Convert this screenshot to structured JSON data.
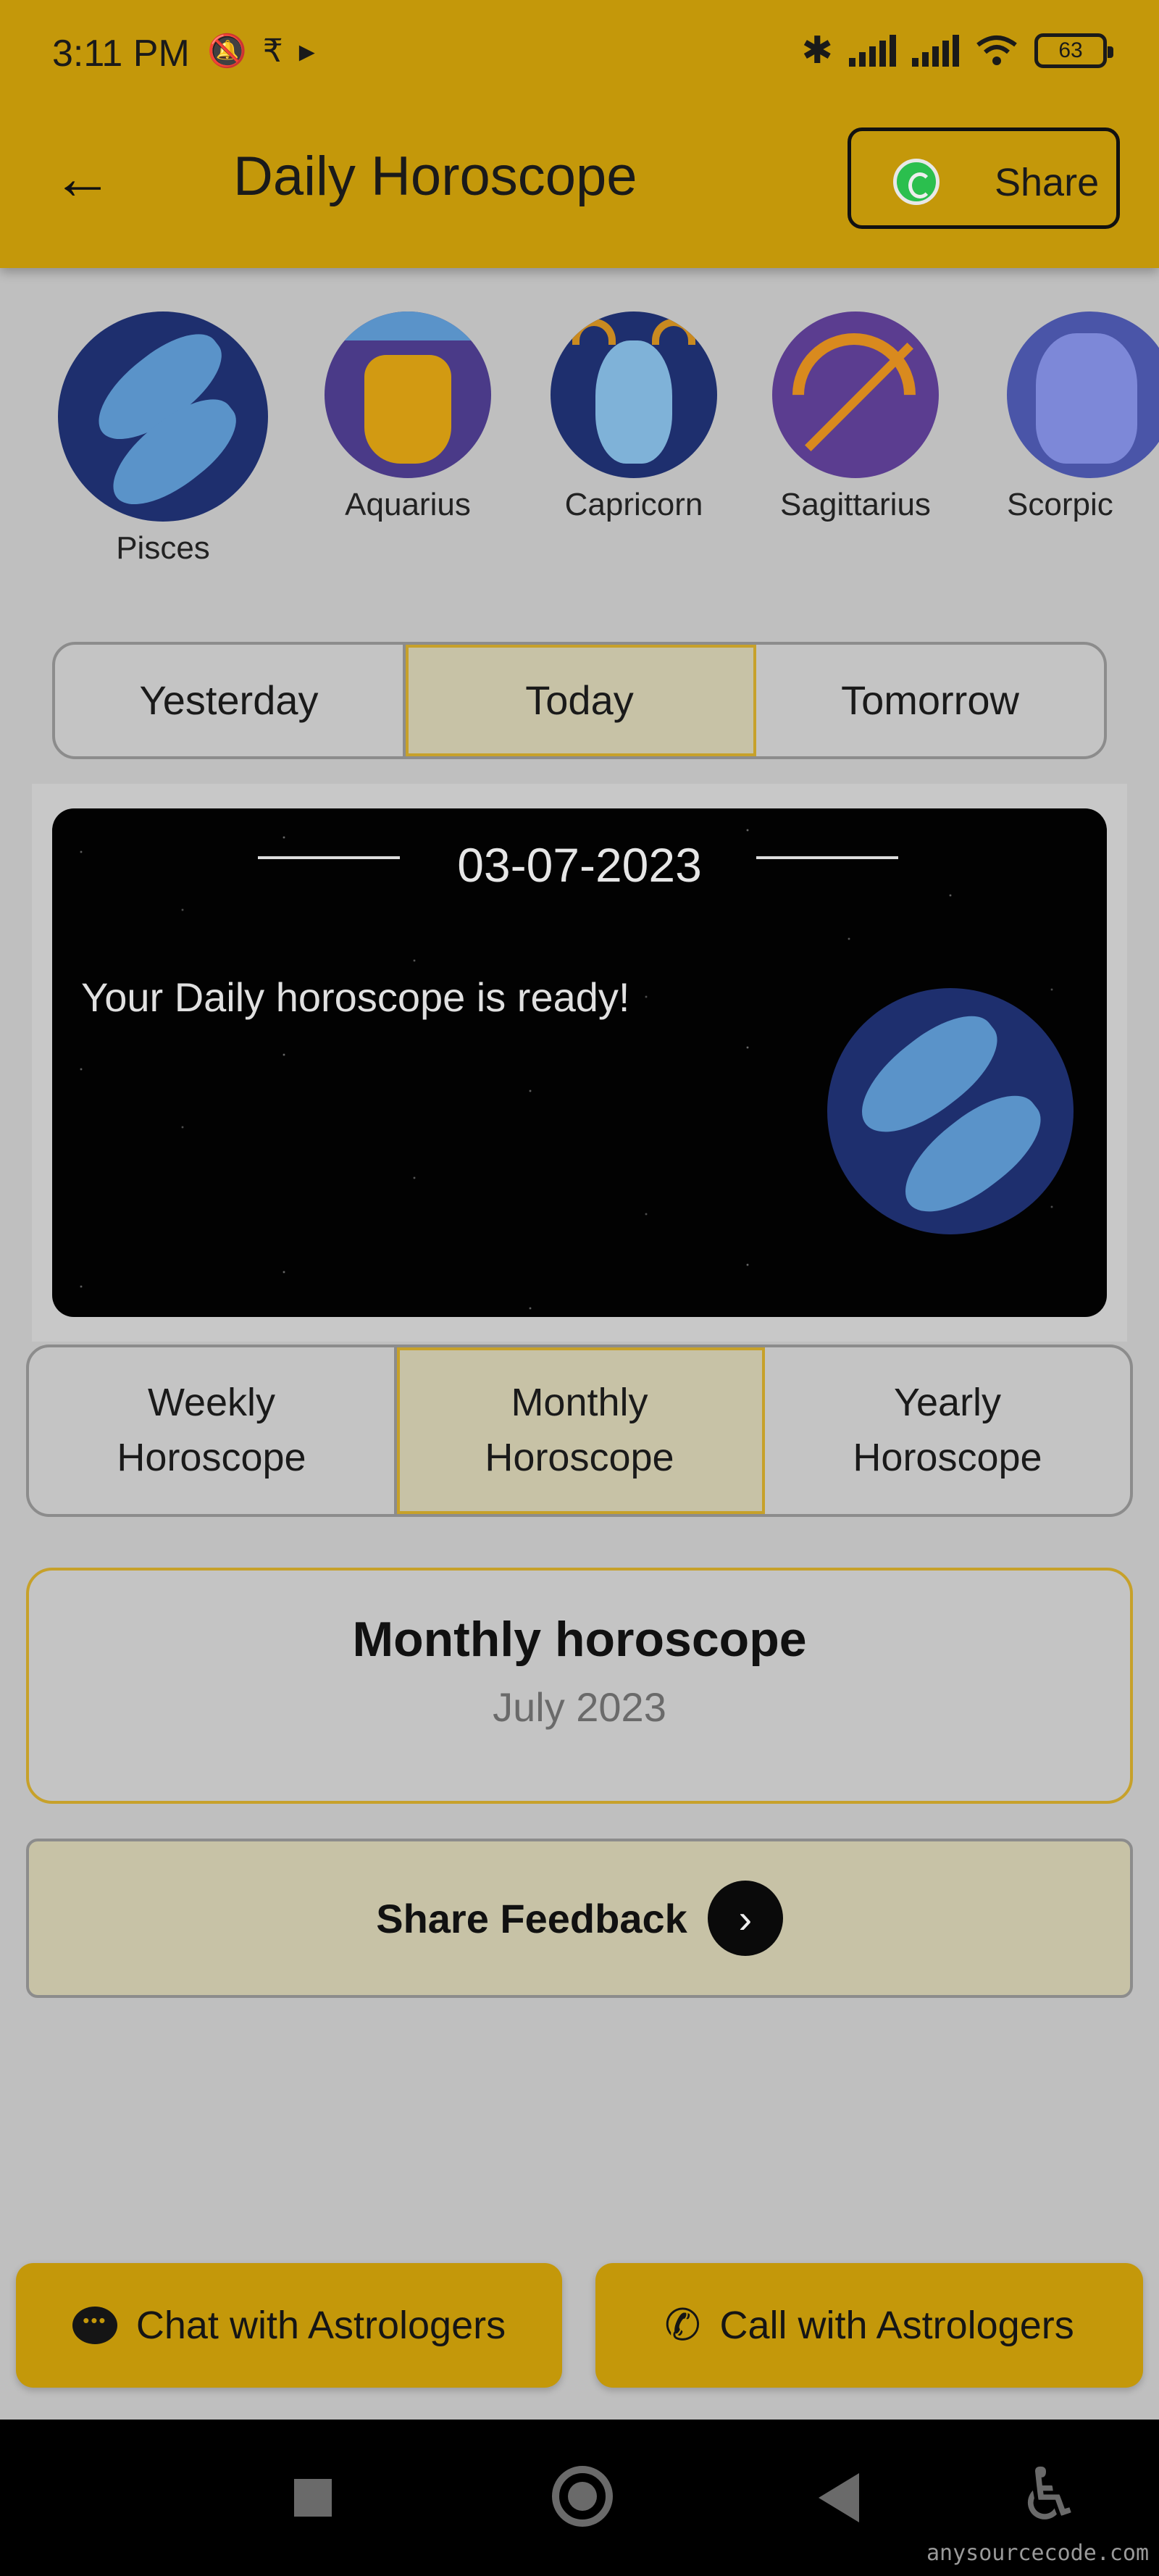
{
  "status_bar": {
    "time": "3:11 PM",
    "icons_left": [
      "mute-icon",
      "rupee-app-icon",
      "play-icon"
    ],
    "icons_right": [
      "bluetooth-icon",
      "signal-icon",
      "signal-icon",
      "wifi-icon",
      "battery-icon"
    ],
    "battery": "63"
  },
  "header": {
    "title": "Daily Horoscope",
    "share_label": "Share",
    "background": "#c4980a"
  },
  "zodiac_signs": [
    {
      "label": "Pisces",
      "selected": true
    },
    {
      "label": "Aquarius"
    },
    {
      "label": "Capricorn"
    },
    {
      "label": "Sagittarius"
    },
    {
      "label": "Scorpio",
      "visible_text": "Scorpic"
    }
  ],
  "day_tabs": {
    "options": [
      "Yesterday",
      "Today",
      "Tomorrow"
    ],
    "selected": "Today"
  },
  "daily_card": {
    "date": "03-07-2023",
    "message": "Your Daily horoscope is ready!"
  },
  "period_tabs": {
    "options": [
      {
        "line1": "Weekly",
        "line2": "Horoscope"
      },
      {
        "line1": "Monthly",
        "line2": "Horoscope"
      },
      {
        "line1": "Yearly",
        "line2": "Horoscope"
      }
    ],
    "selected": "Monthly"
  },
  "monthly": {
    "title": "Monthly horoscope",
    "subtitle": "July 2023"
  },
  "feedback": {
    "label": "Share Feedback"
  },
  "actions": {
    "chat_label": "Chat with Astrologers",
    "call_label": "Call with Astrologers"
  },
  "watermark": "anysourcecode.com",
  "colors": {
    "accent": "#c4980a",
    "highlight_border": "#c7a12a",
    "selected_fill": "#c7c2a6"
  }
}
